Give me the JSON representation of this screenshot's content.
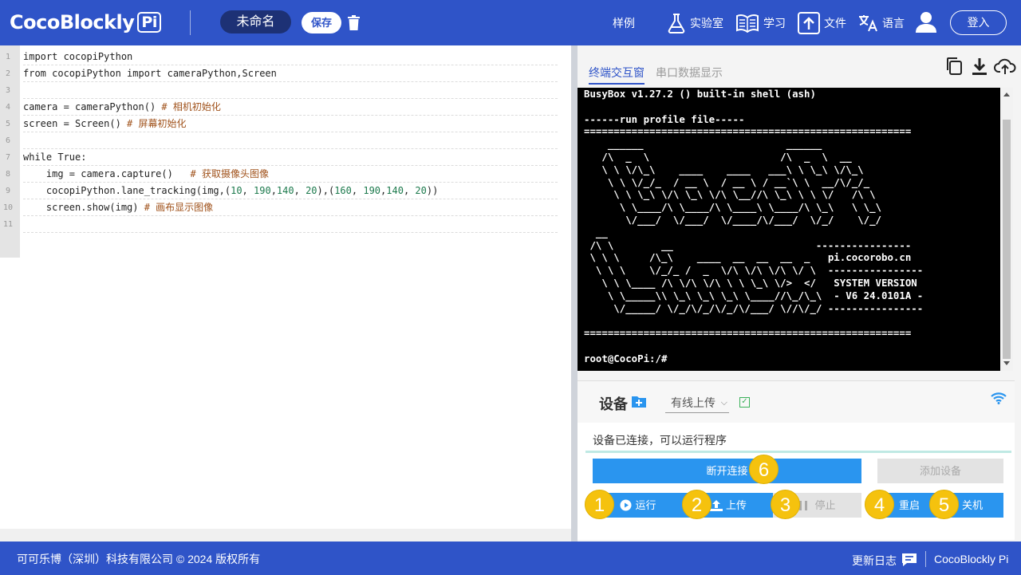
{
  "header": {
    "logo_text": "CocoBlockly",
    "logo_badge": "Pi",
    "project_name": "未命名",
    "save_label": "保存",
    "nav": {
      "examples": "样例",
      "lab": "实验室",
      "learn": "学习",
      "file": "文件",
      "language": "语言"
    },
    "login_label": "登入"
  },
  "editor": {
    "lines": [
      {
        "n": "1",
        "code": "import cocopiPython"
      },
      {
        "n": "2",
        "code": "from cocopiPython import cameraPython,Screen"
      },
      {
        "n": "3",
        "code": ""
      },
      {
        "n": "4",
        "code": "camera = cameraPython() ",
        "comment": "# 相机初始化"
      },
      {
        "n": "5",
        "code": "screen = Screen() ",
        "comment": "# 屏幕初始化"
      },
      {
        "n": "6",
        "code": ""
      },
      {
        "n": "7",
        "code": "while True:"
      },
      {
        "n": "8",
        "code": "    img = camera.capture()   ",
        "comment": "# 获取摄像头图像"
      },
      {
        "n": "9",
        "code": "    cocopiPython.lane_tracking(img,(10, 190,140, 20),(160, 190,140, 20))"
      },
      {
        "n": "10",
        "code": "    screen.show(img) ",
        "comment": "# 画布显示图像"
      },
      {
        "n": "11",
        "code": ""
      }
    ]
  },
  "right": {
    "tab_terminal": "终端交互窗",
    "tab_serial": "串口数据显示",
    "icons": [
      "copy-icon",
      "download-icon",
      "cloud-upload-icon"
    ],
    "terminal_lines": [
      "BusyBox v1.27.2 () built-in shell (ash)",
      "",
      "------run profile file-----",
      "=======================================================",
      "    ______                        ______",
      "   /\\  _  \\                      /\\  _  \\  __",
      "   \\ \\ \\/\\_\\    ____    ____   ___\\ \\ \\_\\ \\/\\_\\",
      "    \\ \\ \\/_/_  / __ \\  / __ \\ / __`\\ \\  __/\\/_/_",
      "     \\ \\ \\_\\ \\/\\ \\_\\ \\/\\ \\__//\\ \\_\\ \\ \\ \\/   /\\ \\",
      "      \\ \\____/\\ \\____/\\ \\____\\ \\____/\\ \\_\\   \\ \\_\\",
      "       \\/___/  \\/___/  \\/____/\\/___/  \\/_/    \\/_/",
      "  __",
      " /\\ \\        __                        ----------------",
      " \\ \\ \\     /\\_\\    ____  __  __  __  _   pi.cocorobo.cn",
      "  \\ \\ \\    \\/_/_ /  _  \\/\\ \\/\\ \\/\\ \\/ \\  ----------------",
      "   \\ \\ \\____ /\\ \\/\\ \\/\\ \\ \\ \\_\\ \\/>  </   SYSTEM VERSION",
      "    \\ \\_____\\\\ \\_\\ \\_\\ \\_\\ \\____//\\_/\\_\\  - V6 24.0101A -",
      "     \\/_____/ \\/_/\\/_/\\/_/\\/___/ \\//\\/_/ ----------------",
      "",
      "=======================================================",
      "",
      "root@CocoPi:/#"
    ]
  },
  "device": {
    "title": "设备",
    "connection_type": "有线上传",
    "status_text": "设备已连接，可以运行程序",
    "disconnect_label": "断开连接",
    "add_device_label": "添加设备",
    "run_label": "运行",
    "upload_label": "上传",
    "stop_label": "停止",
    "restart_label": "重启",
    "shutdown_label": "关机",
    "badges": [
      "1",
      "2",
      "3",
      "4",
      "5",
      "6"
    ]
  },
  "footer": {
    "copyright": "可可乐博（深圳）科技有限公司 © 2024 版权所有",
    "changelog": "更新日志",
    "brand": "CocoBlockly Pi"
  },
  "colors": {
    "header_bg": "#2f54c8",
    "button_blue": "#2a95ef",
    "badge_yellow": "#f5c20e",
    "terminal_bg": "#000000"
  }
}
